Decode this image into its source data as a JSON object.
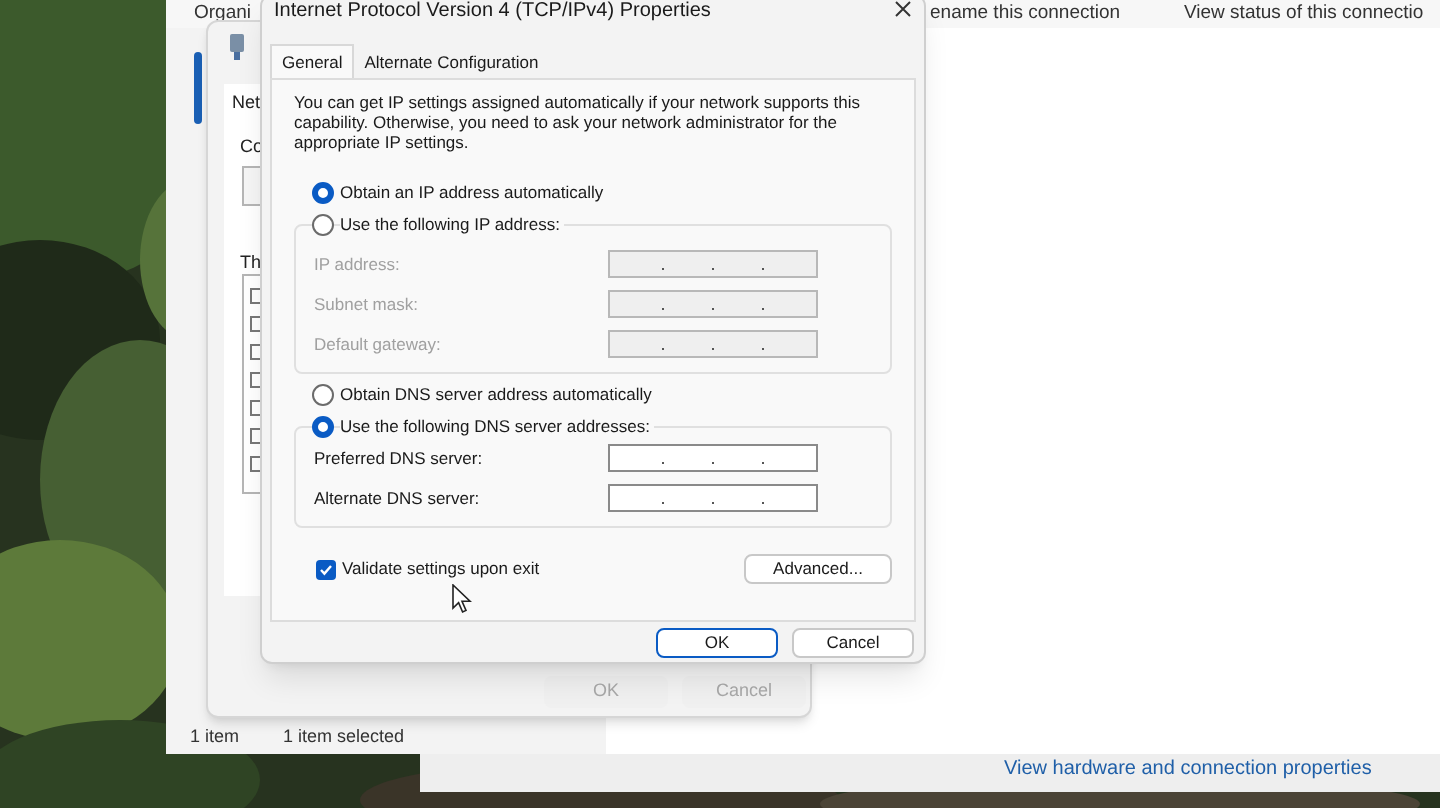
{
  "back_window": {
    "toolbar": [
      "Organi",
      "ename this connection",
      "View status of this connectio"
    ],
    "status_bar": [
      "1 item",
      "1 item selected"
    ],
    "link": "View hardware and connection properties"
  },
  "ethernet_window": {
    "tab": "Net",
    "label_1": "Co",
    "label_2": "Th",
    "buttons": [
      {
        "label": "OK",
        "disabled": true
      },
      {
        "label": "Cancel",
        "disabled": true
      }
    ]
  },
  "dialog": {
    "title": "Internet Protocol Version 4 (TCP/IPv4) Properties",
    "tabs": [
      {
        "label": "General",
        "selected": true
      },
      {
        "label": "Alternate Configuration",
        "selected": false
      }
    ],
    "description": "You can get IP settings assigned automatically if your network supports this capability. Otherwise, you need to ask your network administrator for the appropriate IP settings.",
    "ip_options": [
      {
        "label": "Obtain an IP address automatically",
        "selected": true
      },
      {
        "label": "Use the following IP address:",
        "selected": false
      }
    ],
    "ip_fields": [
      {
        "label": "IP address:",
        "disabled": true
      },
      {
        "label": "Subnet mask:",
        "disabled": true
      },
      {
        "label": "Default gateway:",
        "disabled": true
      }
    ],
    "dns_options": [
      {
        "label": "Obtain DNS server address automatically",
        "selected": false
      },
      {
        "label": "Use the following DNS server addresses:",
        "selected": true
      }
    ],
    "dns_fields": [
      {
        "label": "Preferred DNS server:",
        "disabled": false
      },
      {
        "label": "Alternate DNS server:",
        "disabled": false
      }
    ],
    "validate": {
      "label": "Validate settings upon exit",
      "checked": true
    },
    "advanced_button": "Advanced...",
    "buttons": [
      {
        "label": "OK",
        "default": true
      },
      {
        "label": "Cancel",
        "default": false
      }
    ]
  }
}
